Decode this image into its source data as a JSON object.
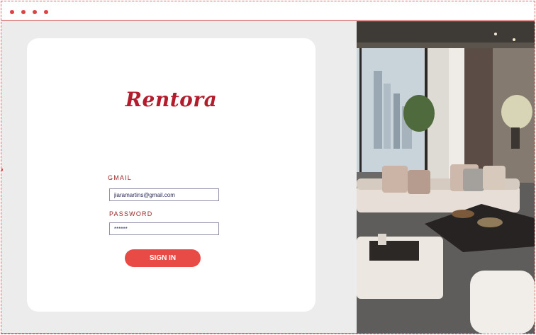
{
  "window": {
    "controls": [
      "dot-1",
      "dot-2",
      "dot-3",
      "dot-4"
    ]
  },
  "brand": {
    "logo_text": "Rentora"
  },
  "login_form": {
    "email_label": "GMAIL",
    "email_value": "jiaramartins@gmail.com",
    "password_label": "PASSWORD",
    "password_value": "******",
    "submit_label": "SIGN IN"
  },
  "colors": {
    "accent": "#e84a45",
    "brand": "#b31c2c",
    "label": "#9a2424",
    "background": "#ececec",
    "card": "#ffffff"
  },
  "hero_image": {
    "icon": "living-room-photo"
  }
}
